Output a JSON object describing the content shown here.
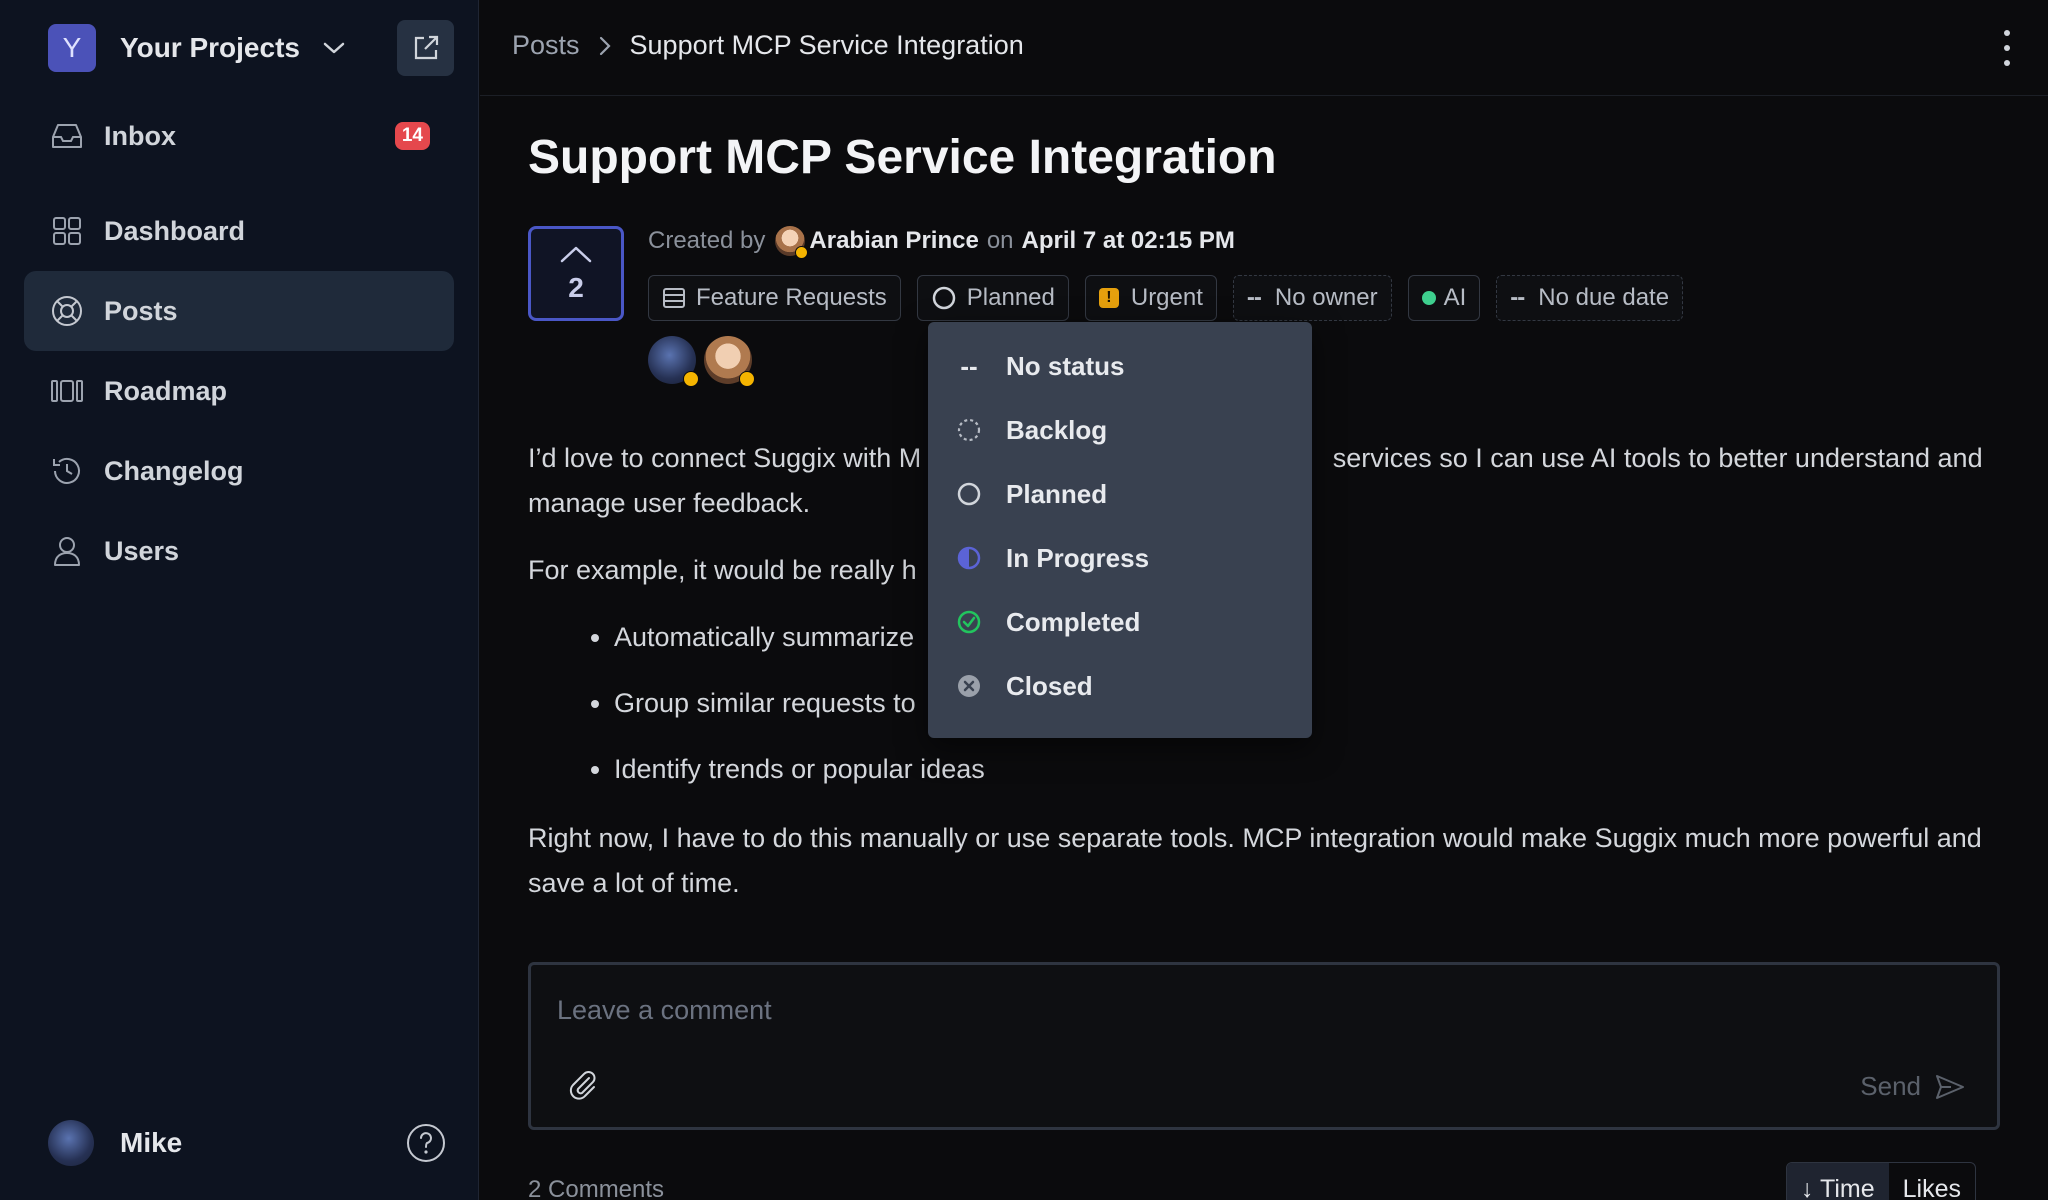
{
  "project": {
    "initial": "Y",
    "name": "Your Projects"
  },
  "nav": [
    {
      "label": "Inbox",
      "badge": "14"
    },
    {
      "label": "Dashboard"
    },
    {
      "label": "Posts",
      "active": true
    },
    {
      "label": "Roadmap"
    },
    {
      "label": "Changelog"
    },
    {
      "label": "Users"
    }
  ],
  "user": {
    "name": "Mike"
  },
  "breadcrumb": {
    "root": "Posts",
    "current": "Support MCP Service Integration"
  },
  "post": {
    "title": "Support MCP Service Integration",
    "votes": "2",
    "created_by_label": "Created by",
    "author": "Arabian Prince",
    "on_label": "on",
    "date": "April 7 at 02:15 PM",
    "board": "Feature Requests",
    "status": "Planned",
    "priority": "Urgent",
    "owner": "No owner",
    "tag": "AI",
    "due": "No due date",
    "paragraph1_a": "I’d love to connect Suggix with M",
    "paragraph1_b": " services so I can use AI tools to better understand and manage user feedback.",
    "paragraph2": "For example, it would be really h",
    "bullets": [
      "Automatically summarize",
      "Group similar requests to",
      "Identify trends or popular ideas"
    ],
    "paragraph3": "Right now, I have to do this manually or use separate tools. MCP integration would make Suggix much more powerful and save a lot of time."
  },
  "comment": {
    "placeholder": "Leave a comment",
    "send": "Send"
  },
  "comments_footer": {
    "count": "2 Comments",
    "sort_time": "↓ Time",
    "sort_likes": "Likes"
  },
  "status_menu": [
    {
      "label": "No status",
      "icon": "dash-icon"
    },
    {
      "label": "Backlog",
      "icon": "dotted-circle-icon"
    },
    {
      "label": "Planned",
      "icon": "circle-icon"
    },
    {
      "label": "In Progress",
      "icon": "half-circle-icon"
    },
    {
      "label": "Completed",
      "icon": "check-circle-icon"
    },
    {
      "label": "Closed",
      "icon": "x-circle-icon"
    }
  ],
  "colors": {
    "accent": "#4a57c6",
    "badge": "#e5484d",
    "urgent": "#e5a00d",
    "ai": "#3ecf8e",
    "completed": "#22c55e",
    "in_progress": "#5b63d6"
  }
}
